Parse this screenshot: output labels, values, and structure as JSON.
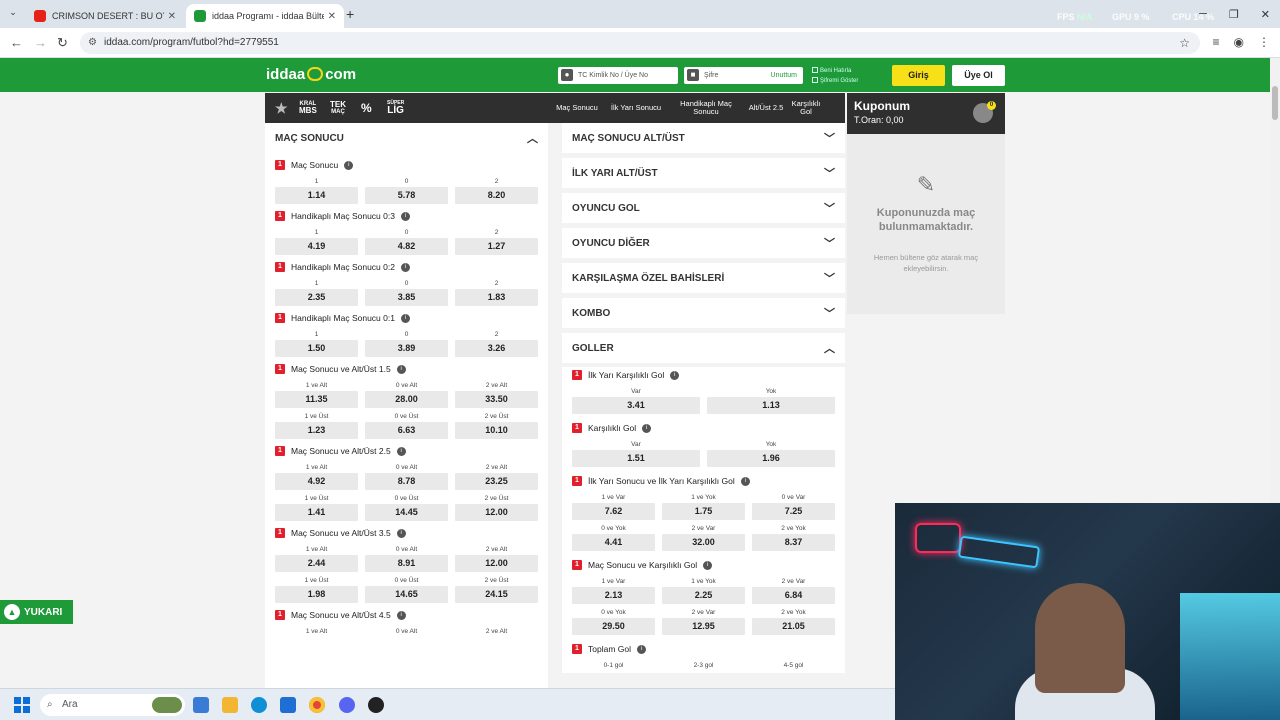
{
  "browser": {
    "tabs": [
      {
        "title": "CRIMSON DESERT : BU OYUN S",
        "active": false
      },
      {
        "title": "iddaa Programı - iddaa Bülteni",
        "active": true
      }
    ],
    "url": "iddaa.com/program/futbol?hd=2779551",
    "perf": {
      "fps_label": "FPS",
      "fps_value": "N/A",
      "gpu_label": "GPU",
      "gpu_value": "9 %",
      "cpu_label": "CPU",
      "cpu_value": "14 %"
    }
  },
  "header": {
    "logo_text": "iddaa",
    "logo_suffix": "com",
    "tc_placeholder": "TC Kimlik No / Üye No",
    "password_placeholder": "Şifre",
    "forgot_label": "Unuttum",
    "remember_label": "Beni Hatırla",
    "remember2_label": "Şifremi Göster",
    "login_label": "Giriş",
    "register_label": "Üye Ol"
  },
  "nav": {
    "left_items": [
      {
        "top": "KRAL",
        "bottom": "MBS"
      },
      {
        "top": "TEK",
        "bottom": "MAÇ"
      },
      {
        "top": "%",
        "bottom": ""
      },
      {
        "top": "SÜPER",
        "bottom": "LİG"
      }
    ],
    "menu": [
      "Maç Sonucu",
      "İlk Yarı Sonucu",
      "Handikaplı Maç Sonucu",
      "Alt/Üst 2.5",
      "Karşılıklı Gol"
    ]
  },
  "left_section": {
    "title": "MAÇ SONUCU",
    "markets": [
      {
        "name": "Maç Sonucu",
        "rows": [
          [
            {
              "l": "1",
              "o": "1.14"
            },
            {
              "l": "0",
              "o": "5.78"
            },
            {
              "l": "2",
              "o": "8.20"
            }
          ]
        ]
      },
      {
        "name": "Handikaplı Maç Sonucu 0:3",
        "rows": [
          [
            {
              "l": "1",
              "o": "4.19"
            },
            {
              "l": "0",
              "o": "4.82"
            },
            {
              "l": "2",
              "o": "1.27"
            }
          ]
        ]
      },
      {
        "name": "Handikaplı Maç Sonucu 0:2",
        "rows": [
          [
            {
              "l": "1",
              "o": "2.35"
            },
            {
              "l": "0",
              "o": "3.85"
            },
            {
              "l": "2",
              "o": "1.83"
            }
          ]
        ]
      },
      {
        "name": "Handikaplı Maç Sonucu 0:1",
        "rows": [
          [
            {
              "l": "1",
              "o": "1.50"
            },
            {
              "l": "0",
              "o": "3.89"
            },
            {
              "l": "2",
              "o": "3.26"
            }
          ]
        ]
      },
      {
        "name": "Maç Sonucu ve Alt/Üst 1.5",
        "rows": [
          [
            {
              "l": "1 ve Alt",
              "o": "11.35"
            },
            {
              "l": "0 ve Alt",
              "o": "28.00"
            },
            {
              "l": "2 ve Alt",
              "o": "33.50"
            }
          ],
          [
            {
              "l": "1 ve Üst",
              "o": "1.23"
            },
            {
              "l": "0 ve Üst",
              "o": "6.63"
            },
            {
              "l": "2 ve Üst",
              "o": "10.10"
            }
          ]
        ]
      },
      {
        "name": "Maç Sonucu ve Alt/Üst 2.5",
        "rows": [
          [
            {
              "l": "1 ve Alt",
              "o": "4.92"
            },
            {
              "l": "0 ve Alt",
              "o": "8.78"
            },
            {
              "l": "2 ve Alt",
              "o": "23.25"
            }
          ],
          [
            {
              "l": "1 ve Üst",
              "o": "1.41"
            },
            {
              "l": "0 ve Üst",
              "o": "14.45"
            },
            {
              "l": "2 ve Üst",
              "o": "12.00"
            }
          ]
        ]
      },
      {
        "name": "Maç Sonucu ve Alt/Üst 3.5",
        "rows": [
          [
            {
              "l": "1 ve Alt",
              "o": "2.44"
            },
            {
              "l": "0 ve Alt",
              "o": "8.91"
            },
            {
              "l": "2 ve Alt",
              "o": "12.00"
            }
          ],
          [
            {
              "l": "1 ve Üst",
              "o": "1.98"
            },
            {
              "l": "0 ve Üst",
              "o": "14.65"
            },
            {
              "l": "2 ve Üst",
              "o": "24.15"
            }
          ]
        ]
      },
      {
        "name": "Maç Sonucu ve Alt/Üst 4.5",
        "rows": [
          [
            {
              "l": "1 ve Alt",
              "o": ""
            },
            {
              "l": "0 ve Alt",
              "o": ""
            },
            {
              "l": "2 ve Alt",
              "o": ""
            }
          ]
        ]
      }
    ]
  },
  "right_section": {
    "collapsed": [
      "MAÇ SONUCU ALT/ÜST",
      "İLK YARI ALT/ÜST",
      "OYUNCU GOL",
      "OYUNCU DİĞER",
      "KARŞILAŞMA ÖZEL BAHİSLERİ",
      "KOMBO"
    ],
    "open_title": "GOLLER",
    "markets": [
      {
        "name": "İlk Yarı Karşılıklı Gol",
        "rows": [
          [
            {
              "l": "Var",
              "o": "3.41"
            },
            {
              "l": "Yok",
              "o": "1.13"
            }
          ]
        ]
      },
      {
        "name": "Karşılıklı Gol",
        "rows": [
          [
            {
              "l": "Var",
              "o": "1.51"
            },
            {
              "l": "Yok",
              "o": "1.96"
            }
          ]
        ]
      },
      {
        "name": "İlk Yarı Sonucu ve İlk Yarı Karşılıklı Gol",
        "rows": [
          [
            {
              "l": "1 ve Var",
              "o": "7.62"
            },
            {
              "l": "1 ve Yok",
              "o": "1.75"
            },
            {
              "l": "0 ve Var",
              "o": "7.25"
            }
          ],
          [
            {
              "l": "0 ve Yok",
              "o": "4.41"
            },
            {
              "l": "2 ve Var",
              "o": "32.00"
            },
            {
              "l": "2 ve Yok",
              "o": "8.37"
            }
          ]
        ]
      },
      {
        "name": "Maç Sonucu ve Karşılıklı Gol",
        "rows": [
          [
            {
              "l": "1 ve Var",
              "o": "2.13"
            },
            {
              "l": "1 ve Yok",
              "o": "2.25"
            },
            {
              "l": "2 ve Var",
              "o": "6.84"
            }
          ],
          [
            {
              "l": "0 ve Yok",
              "o": "29.50"
            },
            {
              "l": "2 ve Var",
              "o": "12.95"
            },
            {
              "l": "2 ve Yok",
              "o": "21.05"
            }
          ]
        ]
      },
      {
        "name": "Toplam Gol",
        "rows": [
          [
            {
              "l": "0-1 gol",
              "o": ""
            },
            {
              "l": "2-3 gol",
              "o": ""
            },
            {
              "l": "4-5 gol",
              "o": ""
            }
          ]
        ]
      }
    ]
  },
  "coupon": {
    "title": "Kuponum",
    "total": "T.Oran: 0,00",
    "count": "0",
    "empty_message": "Kuponunuzda maç bulunmamaktadır.",
    "hint": "Hemen bültene göz atarak maç ekleyebilirsin."
  },
  "scroll_top_label": "YUKARI",
  "taskbar": {
    "search_placeholder": "Ara"
  }
}
